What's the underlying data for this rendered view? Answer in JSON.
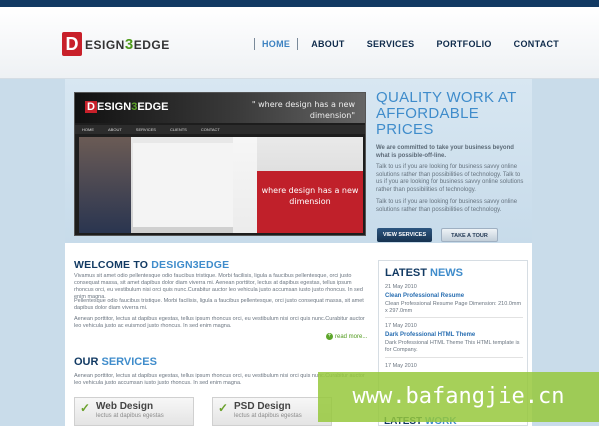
{
  "header": {
    "logo": {
      "mark": "D",
      "text_prefix": "ESIGN",
      "text_accent": "3",
      "text_suffix": "EDGE"
    },
    "nav": [
      "HOME",
      "ABOUT",
      "SERVICES",
      "PORTFOLIO",
      "CONTACT"
    ],
    "active_nav": "HOME"
  },
  "hero": {
    "logo_prefix": "D",
    "logo_mid": "ESIGN",
    "logo_accent": "3",
    "logo_suffix": "EDGE",
    "quote": "\" where design has a new dimension\"",
    "nav": [
      "HOME",
      "ABOUT",
      "SERVICES",
      "CLIENTS",
      "CONTACT"
    ],
    "red_text": "where design has a new dimension"
  },
  "quality": {
    "title": "QUALITY WORK AT AFFORDABLE PRICES",
    "strong": "We are committed to take your business beyond what is possible-off-line.",
    "paragraphs": [
      "Talk to us if you are looking for business savvy online solutions rather than possibilities of technology. Talk to us if you are looking for business savvy online solutions rather than possibilities of technology.",
      "Talk to us if you are looking for business savvy online solutions rather than possibilities of technology."
    ],
    "btn_view": "VIEW SERVICES",
    "btn_tour": "TAKE A TOUR"
  },
  "welcome": {
    "title_dark": "WELCOME TO ",
    "title_hl": "DESIGN3EDGE",
    "paragraphs": [
      "Vivamus sit amet odio pellentesque odio faucibus tristique. Morbi facilisis, ligula a faucibus pellentesque, orci justo consequat massa, sit amet dapibus dolor diam viverra mi. Aenean porttitor, lectus at dapibus egestas, tellus ipsum rhoncus orci, eu vestibulum nisi orci quis nunc.Curabitur auctor leo vehicula justo accumsan iusto justo rhoncus. In sed enim magna.",
      "Pellentesque odio faucibus tristique. Morbi facilisis, ligula a faucibus pellentesque, orci justo consequat massa, sit amet dapibus dolor diam viverra mi.",
      "Aenean porttitor, lectus at dapibus egestas, tellus ipsum rhoncus orci, eu vestibulum nisi orci quis nunc.Curabitur auctor leo vehicula justo ac euismod justo rhoncus. In sed enim magna."
    ],
    "read_more": "read more..."
  },
  "services": {
    "title_dark": "OUR ",
    "title_hl": "SERVICES",
    "paragraph": "Aenean porttitor, lectus at dapibus egestas, tellus ipsum rhoncus orci, eu vestibulum nisi orci quis nunc.Curabitur auctor leo vehicula justo accumsan iusto justo rhoncus. In sed enim magna.",
    "items": [
      {
        "title": "Web Design",
        "sub": "lectus at dapibus egestas"
      },
      {
        "title": "PSD Design",
        "sub": "lectus at dapibus egestas"
      }
    ]
  },
  "news": {
    "title_dark": "LATEST ",
    "title_hl": "NEWS",
    "items": [
      {
        "date": "21 May 2010",
        "title": "Clean Professional Resume",
        "text": "Clean Professional Resume Page Dimension: 210.0mm x 297.0mm"
      },
      {
        "date": "17 May 2010",
        "title": "Dark Professional HTML Theme",
        "text": "Dark Professional HTML Theme This HTML template is for Company."
      },
      {
        "date": "17 May 2010"
      }
    ]
  },
  "work": {
    "title_dark": "LATEST ",
    "title_hl": "WORK"
  },
  "watermark": "www.bafangjie.cn",
  "colors": {
    "navy": "#123a63",
    "accent": "#3f8ccb",
    "red": "#c8202a",
    "green": "#5da62a"
  }
}
